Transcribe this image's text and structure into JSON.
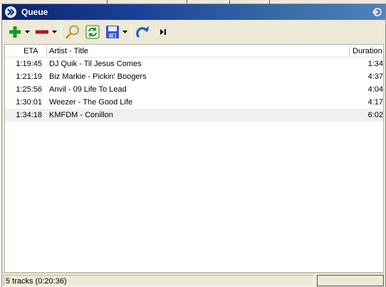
{
  "window": {
    "title": "Queue"
  },
  "toolbar": {
    "add": "plus-icon",
    "remove": "minus-icon",
    "search": "magnifier-icon",
    "refresh": "refresh-icon",
    "save": "floppy-icon",
    "repeat": "redo-arrow-icon",
    "skip": "skip-next-icon"
  },
  "columns": {
    "eta": "ETA",
    "title": "Artist - Title",
    "duration": "Duration"
  },
  "tracks": [
    {
      "eta": "1:19:45",
      "title": "DJ Quik - Til Jesus Comes",
      "duration": "1:34"
    },
    {
      "eta": "1:21:19",
      "title": "Biz Markie - Pickin' Boogers",
      "duration": "4:37"
    },
    {
      "eta": "1:25:56",
      "title": "Anvil - 09 Life To Lead",
      "duration": "4:04"
    },
    {
      "eta": "1:30:01",
      "title": "Weezer - The Good Life",
      "duration": "4:17"
    },
    {
      "eta": "1:34:18",
      "title": "KMFDM - Conillon",
      "duration": "6:02"
    }
  ],
  "status": {
    "text": "5 tracks (0:20:36)"
  },
  "colors": {
    "titlebar": "#0a246a",
    "add": "#1a9a1a",
    "remove": "#b01818",
    "repeat": "#1f5fbf"
  }
}
